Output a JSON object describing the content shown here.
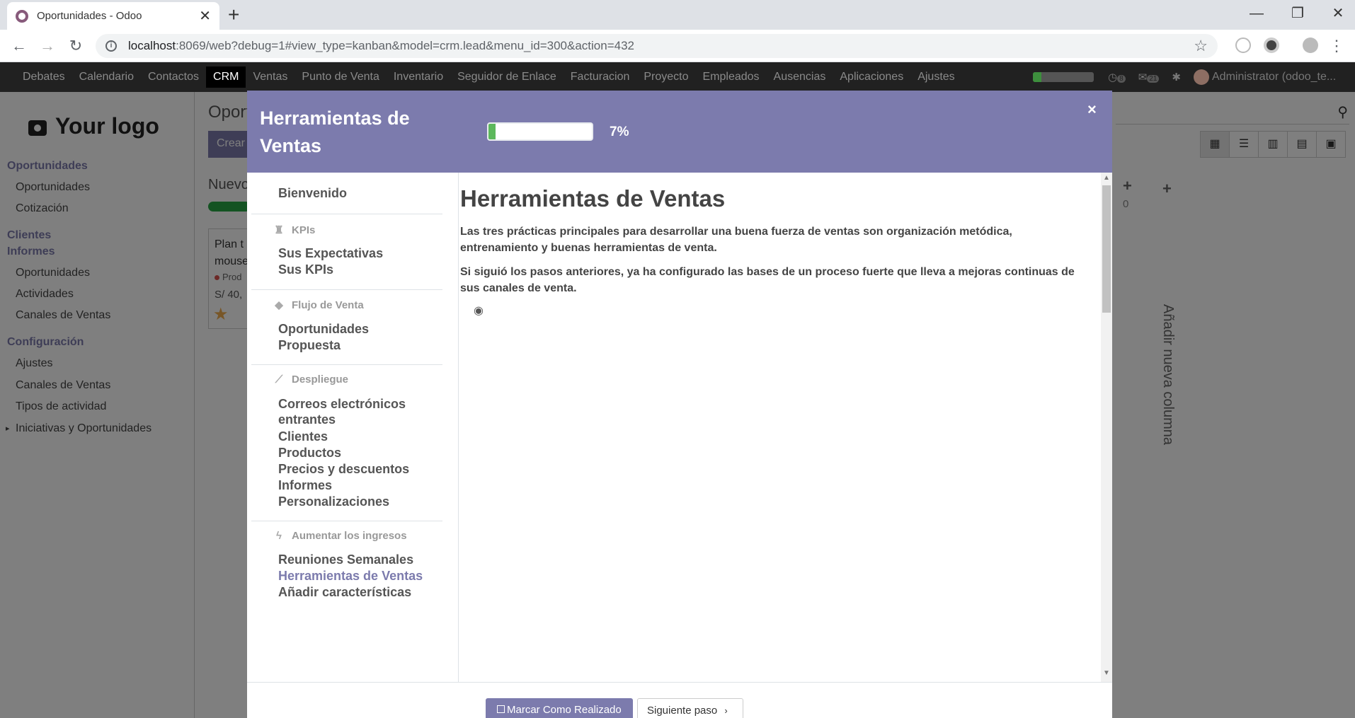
{
  "browser": {
    "tab_title": "Oportunidades - Odoo",
    "tab_close": "✕",
    "new_tab": "+",
    "url_host": "localhost",
    "url_rest": ":8069/web?debug=1#view_type=kanban&model=crm.lead&menu_id=300&action=432",
    "win_min": "—",
    "win_max": "❐",
    "win_close": "✕"
  },
  "topnav": {
    "apps": [
      "Debates",
      "Calendario",
      "Contactos",
      "CRM",
      "Ventas",
      "Punto de Venta",
      "Inventario",
      "Seguidor de Enlace",
      "Facturacion",
      "Proyecto",
      "Empleados",
      "Ausencias",
      "Aplicaciones",
      "Ajustes"
    ],
    "active_app": "CRM",
    "activity_count": "8",
    "message_count": "21",
    "user": "Administrator (odoo_te..."
  },
  "sidebar": {
    "logo": "Your logo",
    "sections": [
      {
        "label": "Oportunidades",
        "items": [
          "Oportunidades",
          "Cotización"
        ]
      },
      {
        "label": "Clientes",
        "items": []
      },
      {
        "label": "Informes",
        "items": [
          "Oportunidades",
          "Actividades",
          "Canales de Ventas"
        ]
      },
      {
        "label": "Configuración",
        "items": [
          "Ajustes",
          "Canales de Ventas",
          "Tipos de actividad",
          "Iniciativas y Oportunidades"
        ]
      }
    ]
  },
  "background": {
    "title": "Oport",
    "create": "Crear",
    "stage": "Nuevo",
    "card_title": "Plan t mouse",
    "card_tag": "Prod",
    "card_amount": "S/ 40,",
    "column_count": "0",
    "add_column": "Añadir nueva columna"
  },
  "modal": {
    "title": "Herramientas de Ventas",
    "progress_pct": 7,
    "progress_label": "7%",
    "close": "×",
    "nav": {
      "welcome": "Bienvenido",
      "categories": [
        {
          "label": "KPIs",
          "icon": "trophy-icon",
          "items": [
            "Sus Expectativas",
            "Sus KPIs"
          ]
        },
        {
          "label": "Flujo de Venta",
          "icon": "tag-icon",
          "items": [
            "Oportunidades",
            "Propuesta"
          ]
        },
        {
          "label": "Despliegue",
          "icon": "magic-wand-icon",
          "items": [
            "Correos electrónicos entrantes",
            "Clientes",
            "Productos",
            "Precios y descuentos",
            "Informes",
            "Personalizaciones"
          ]
        },
        {
          "label": "Aumentar los ingresos",
          "icon": "bolt-icon",
          "items": [
            "Reuniones Semanales",
            "Herramientas de Ventas",
            "Añadir características"
          ]
        }
      ],
      "active_item": "Herramientas de Ventas"
    },
    "content": {
      "heading": "Herramientas de Ventas",
      "paragraphs": [
        "Las tres prácticas principales para desarrollar una buena fuerza de ventas son organización metódica, entrenamiento y buenas herramientas de venta.",
        "Si siguió los pasos anteriores, ya ha configurado las bases de un proceso fuerte que lleva a mejoras continuas de sus canales de venta."
      ]
    },
    "footer": {
      "mark_done": "Marcar Como Realizado",
      "next_step": "Siguiente paso"
    }
  },
  "colors": {
    "accent": "#7c7bad",
    "progress_green": "#5cb85c",
    "topnav_bg": "#212121"
  }
}
